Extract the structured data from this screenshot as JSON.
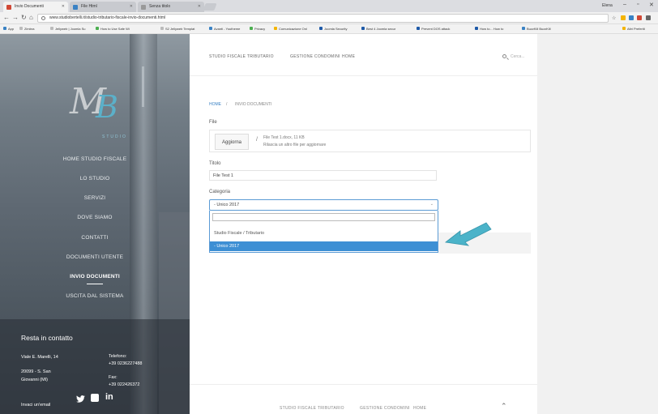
{
  "browser": {
    "tabs": [
      {
        "label": "Invio Documenti",
        "color": "#d14836"
      },
      {
        "label": "File Html",
        "color": "#3a82c4"
      },
      {
        "label": "Senza titolo",
        "color": "#888888"
      }
    ],
    "user": "Elena",
    "url": "www.studiobertelli.it/studio-tributario-fiscale-invio-documenti.html",
    "bookmarks": [
      "App",
      "Zimbra",
      "Jellyweb | Joomla Su",
      "How to Use Safe Wi",
      "S2 Jellyweb Templat",
      "Avanti - Youtheme",
      "Privacy",
      "Comunicazione Onl",
      "Joomla Security",
      "Best 4 Joomla secur",
      "Prevent DOS attack",
      "How to... How to",
      "BuzzKill BuzzKill",
      "Altri Preferiti"
    ]
  },
  "sidebar": {
    "logo_sub": "STUDIO",
    "menu": [
      {
        "label": "HOME STUDIO FISCALE",
        "active": false
      },
      {
        "label": "LO STUDIO",
        "active": false
      },
      {
        "label": "SERVIZI",
        "active": false
      },
      {
        "label": "DOVE SIAMO",
        "active": false
      },
      {
        "label": "CONTATTI",
        "active": false
      },
      {
        "label": "DOCUMENTI UTENTE",
        "active": false
      },
      {
        "label": "INVIO DOCUMENTI",
        "active": true
      },
      {
        "label": "USCITA DAL SISTEMA",
        "active": false
      }
    ],
    "contact": {
      "title": "Resta in contatto",
      "address_1": "Viale E. Marelli, 14",
      "address_2": "20099 - S. San",
      "address_3": "Giovanni (MI)",
      "phone_label": "Telefono:",
      "phone": "+39 0236227488",
      "fax_label": "Fax:",
      "fax": "+39 022426372",
      "email_cta": "Invaci un'email"
    },
    "social": [
      "twitter-icon",
      "linkedin-square-icon",
      "in"
    ]
  },
  "main": {
    "topnav": [
      "STUDIO FISCALE TRIBUTARIO",
      "GESTIONE CONDOMINI",
      "HOME"
    ],
    "search_placeholder": "Cerca...",
    "breadcrumb": {
      "home": "HOME",
      "sep": "/",
      "current": "INVIO DOCUMENTI"
    },
    "file": {
      "label": "File",
      "button": "Aggiorna",
      "filename": "File Test 1.docx, 11 KB",
      "hint": "Rilascia un altro file per aggiornare"
    },
    "titolo": {
      "label": "Titolo",
      "value": "File Test 1"
    },
    "categoria": {
      "label": "Categoria",
      "selected": "- Unico 2017",
      "search_value": "",
      "options": [
        {
          "label": "Studio Fiscale / Tributario",
          "selected": false
        },
        {
          "label": "- Unico 2017",
          "selected": true
        }
      ]
    },
    "footer_nav": [
      "STUDIO FISCALE TRIBUTARIO",
      "GESTIONE CONDOMINI",
      "HOME"
    ]
  },
  "colors": {
    "accent": "#3d8fd4",
    "arrow": "#4bb3c9"
  }
}
